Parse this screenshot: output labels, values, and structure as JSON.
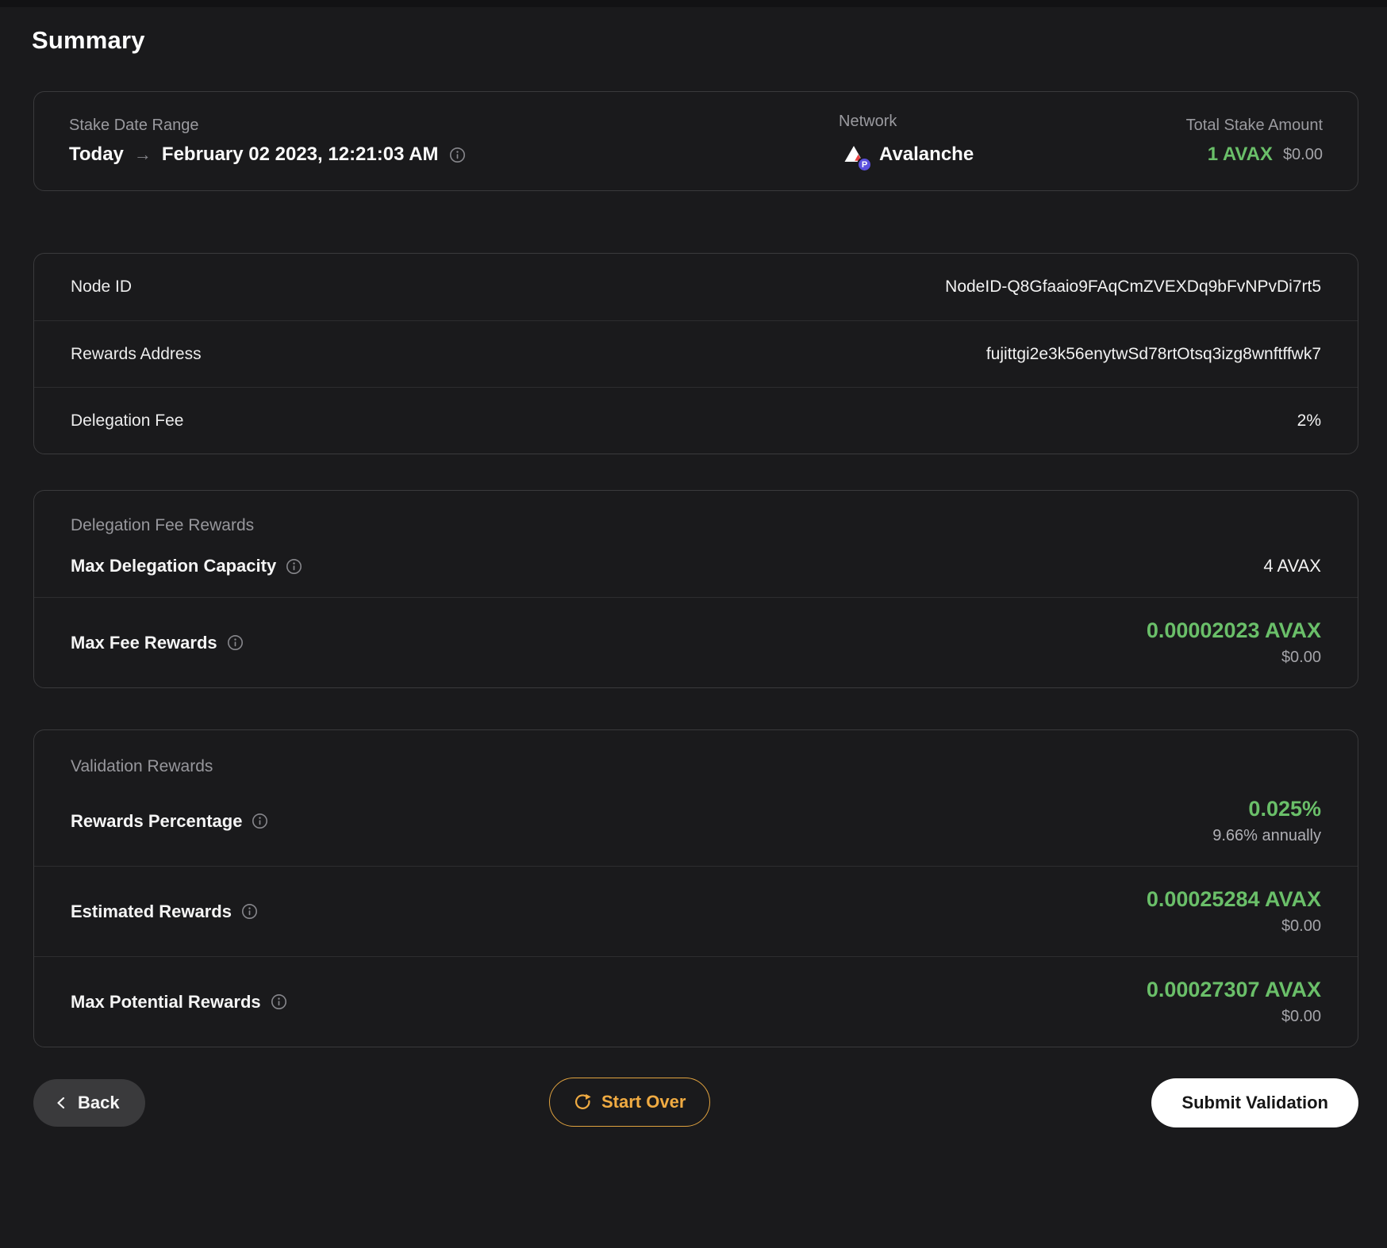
{
  "page": {
    "title": "Summary"
  },
  "summary_card": {
    "stake_date": {
      "label": "Stake Date Range",
      "from": "Today",
      "arrow": "→",
      "to": "February 02 2023, 12:21:03 AM"
    },
    "network": {
      "label": "Network",
      "value": "Avalanche",
      "badge": "P"
    },
    "total_stake": {
      "label": "Total Stake Amount",
      "amount": "1 AVAX",
      "usd": "$0.00"
    }
  },
  "details_table": {
    "rows": [
      {
        "label": "Node ID",
        "value": "NodeID-Q8Gfaaio9FAqCmZVEXDq9bFvNPvDi7rt5"
      },
      {
        "label": "Rewards Address",
        "value": "fujittgi2e3k56enytwSd78rtOtsq3izg8wnftffwk7"
      },
      {
        "label": "Delegation Fee",
        "value": "2%"
      }
    ]
  },
  "delegation_fee_rewards": {
    "title": "Delegation Fee Rewards",
    "max_delegation_capacity": {
      "label": "Max Delegation Capacity",
      "value": "4 AVAX"
    },
    "max_fee_rewards": {
      "label": "Max Fee Rewards",
      "value": "0.00002023 AVAX",
      "usd": "$0.00"
    }
  },
  "validation_rewards": {
    "title": "Validation Rewards",
    "rewards_percentage": {
      "label": "Rewards Percentage",
      "value": "0.025%",
      "sub": "9.66% annually"
    },
    "estimated_rewards": {
      "label": "Estimated Rewards",
      "value": "0.00025284 AVAX",
      "usd": "$0.00"
    },
    "max_potential_rewards": {
      "label": "Max Potential Rewards",
      "value": "0.00027307 AVAX",
      "usd": "$0.00"
    }
  },
  "footer": {
    "back_label": "Back",
    "start_over_label": "Start Over",
    "submit_label": "Submit Validation"
  },
  "colors": {
    "accent_green": "#6abf69",
    "accent_orange": "#f0ab42",
    "avalanche_red": "#e84142",
    "p_chain_purple": "#5b50dd"
  }
}
